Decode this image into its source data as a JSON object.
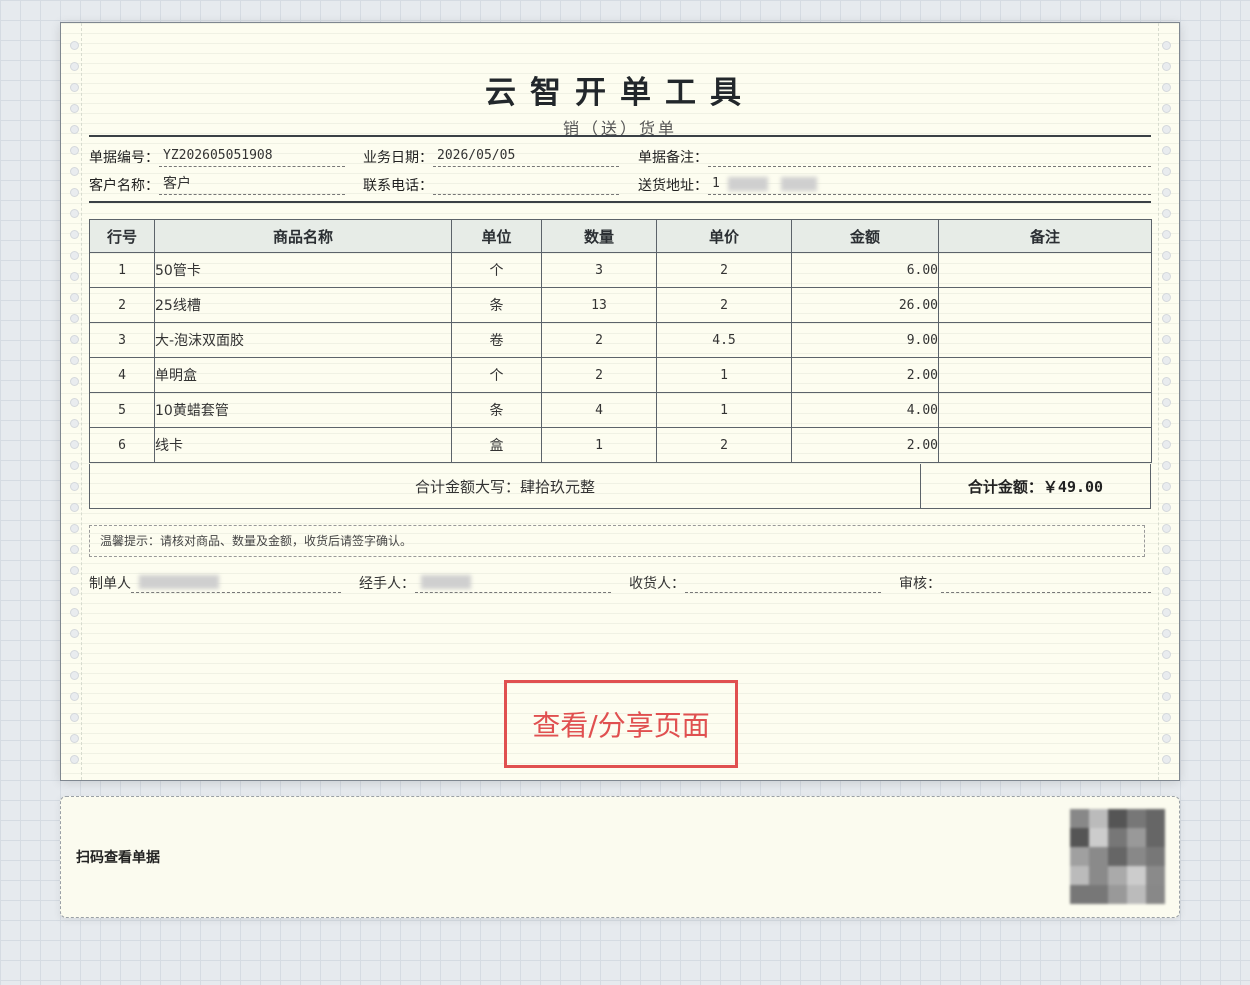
{
  "header": {
    "title": "云智开单工具",
    "subtitle": "销（送）货单"
  },
  "info": {
    "doc_no_label": "单据编号：",
    "doc_no": "YZ202605051908",
    "date_label": "业务日期：",
    "date": "2026/05/05",
    "remark_label": "单据备注：",
    "remark": "",
    "customer_label": "客户名称：",
    "customer": "客户",
    "phone_label": "联系电话：",
    "phone": "",
    "address_label": "送货地址：",
    "address_prefix": "1"
  },
  "table": {
    "headers": [
      "行号",
      "商品名称",
      "单位",
      "数量",
      "单价",
      "金额",
      "备注"
    ],
    "rows": [
      {
        "no": "1",
        "name": "50管卡",
        "unit": "个",
        "qty": "3",
        "price": "2",
        "amount": "6.00",
        "note": ""
      },
      {
        "no": "2",
        "name": "25线槽",
        "unit": "条",
        "qty": "13",
        "price": "2",
        "amount": "26.00",
        "note": ""
      },
      {
        "no": "3",
        "name": "大-泡沫双面胶",
        "unit": "卷",
        "qty": "2",
        "price": "4.5",
        "amount": "9.00",
        "note": ""
      },
      {
        "no": "4",
        "name": "单明盒",
        "unit": "个",
        "qty": "2",
        "price": "1",
        "amount": "2.00",
        "note": ""
      },
      {
        "no": "5",
        "name": "10黄蜡套管",
        "unit": "条",
        "qty": "4",
        "price": "1",
        "amount": "4.00",
        "note": ""
      },
      {
        "no": "6",
        "name": "线卡",
        "unit": "盒",
        "qty": "1",
        "price": "2",
        "amount": "2.00",
        "note": ""
      }
    ]
  },
  "totals": {
    "words_label": "合计金额大写：",
    "words": "肆拾玖元整",
    "amount_label": "合计金额：",
    "amount": "￥49.00"
  },
  "tip": "温馨提示：请核对商品、数量及金额，收货后请签字确认。",
  "signatures": {
    "maker": "制单人",
    "handler": "经手人：",
    "receiver": "收货人：",
    "auditor": "审核："
  },
  "overlay": {
    "view_share": "查看/分享页面"
  },
  "qr": {
    "label": "扫码查看单据"
  },
  "colors": {
    "paper": "#fdfdf0",
    "accent_red": "#e05050",
    "border": "#5c636a"
  }
}
